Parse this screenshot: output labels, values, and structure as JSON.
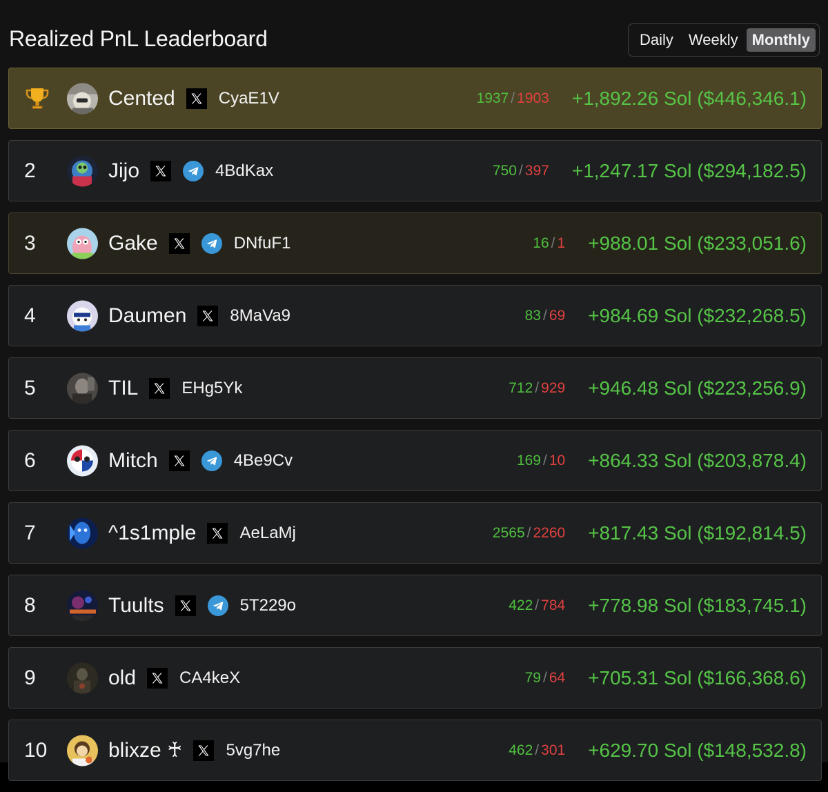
{
  "title": "Realized PnL Leaderboard",
  "periods": [
    "Daily",
    "Weekly",
    "Monthly"
  ],
  "active_period": "Monthly",
  "colors": {
    "win": "#4fbf3e",
    "loss": "#e0413f",
    "pnl": "#55c447",
    "first_place_row": "#4c4525",
    "third_place_row": "#25231a"
  },
  "entries": [
    {
      "rank": "1",
      "rank_icon": "trophy-icon",
      "name": "Cented",
      "has_x": true,
      "has_telegram": false,
      "wallet": "CyaE1V",
      "wins": "1937",
      "losses": "1903",
      "pnl": "+1,892.26 Sol ($446,346.1)"
    },
    {
      "rank": "2",
      "name": "Jijo",
      "has_x": true,
      "has_telegram": true,
      "wallet": "4BdKax",
      "wins": "750",
      "losses": "397",
      "pnl": "+1,247.17 Sol ($294,182.5)"
    },
    {
      "rank": "3",
      "name": "Gake",
      "has_x": true,
      "has_telegram": true,
      "wallet": "DNfuF1",
      "wins": "16",
      "losses": "1",
      "pnl": "+988.01 Sol ($233,051.6)"
    },
    {
      "rank": "4",
      "name": "Daumen",
      "has_x": true,
      "has_telegram": false,
      "wallet": "8MaVa9",
      "wins": "83",
      "losses": "69",
      "pnl": "+984.69 Sol ($232,268.5)"
    },
    {
      "rank": "5",
      "name": "TIL",
      "has_x": true,
      "has_telegram": false,
      "wallet": "EHg5Yk",
      "wins": "712",
      "losses": "929",
      "pnl": "+946.48 Sol ($223,256.9)"
    },
    {
      "rank": "6",
      "name": "Mitch",
      "has_x": true,
      "has_telegram": true,
      "wallet": "4Be9Cv",
      "wins": "169",
      "losses": "10",
      "pnl": "+864.33 Sol ($203,878.4)"
    },
    {
      "rank": "7",
      "name": "^1s1mple",
      "has_x": true,
      "has_telegram": false,
      "wallet": "AeLaMj",
      "wins": "2565",
      "losses": "2260",
      "pnl": "+817.43 Sol ($192,814.5)"
    },
    {
      "rank": "8",
      "name": "Tuults",
      "has_x": true,
      "has_telegram": true,
      "wallet": "5T229o",
      "wins": "422",
      "losses": "784",
      "pnl": "+778.98 Sol ($183,745.1)"
    },
    {
      "rank": "9",
      "name": "old",
      "has_x": true,
      "has_telegram": false,
      "wallet": "CA4keX",
      "wins": "79",
      "losses": "64",
      "pnl": "+705.31 Sol ($166,368.6)"
    },
    {
      "rank": "10",
      "name": "blixze ♰",
      "has_x": true,
      "has_telegram": false,
      "wallet": "5vg7he",
      "wins": "462",
      "losses": "301",
      "pnl": "+629.70 Sol ($148,532.8)"
    }
  ]
}
